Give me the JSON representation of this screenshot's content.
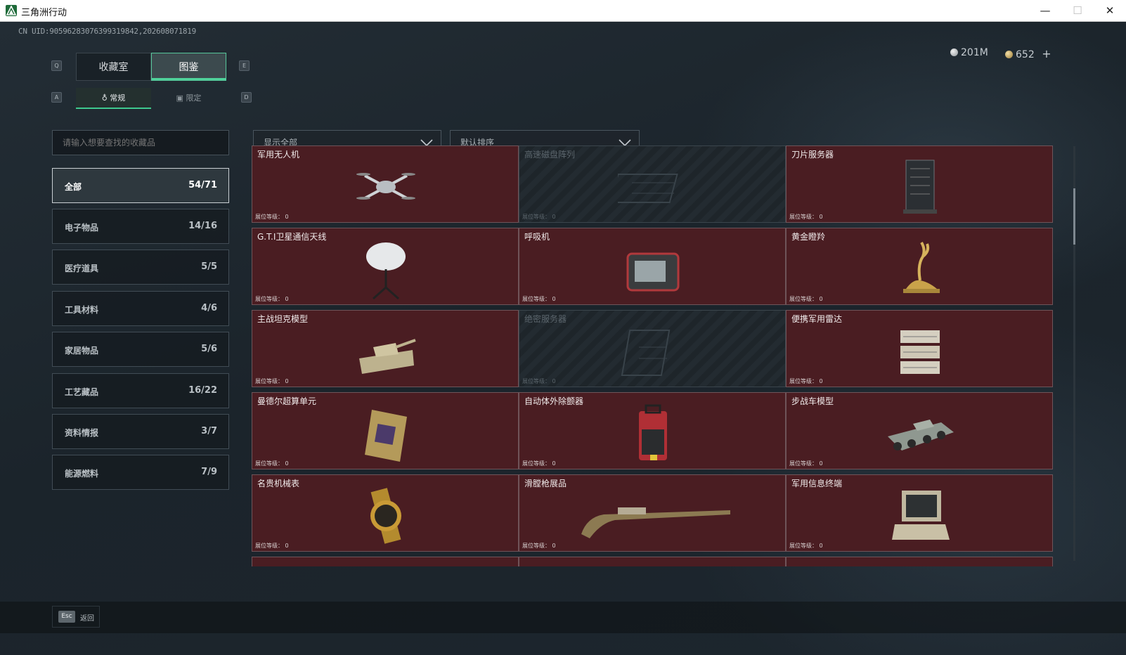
{
  "window": {
    "title": "三角洲行动",
    "minimize": "—",
    "maximize": "☐",
    "close": "✕"
  },
  "uid": "CN UID:9059628307639931984​2,202608071819",
  "keys": {
    "q": "Q",
    "e": "E",
    "a": "A",
    "d": "D",
    "esc": "Esc"
  },
  "main_tabs": [
    {
      "label": "收藏室"
    },
    {
      "label": "图鉴"
    }
  ],
  "sub_tabs": [
    {
      "label": "常规"
    },
    {
      "label": "限定"
    }
  ],
  "currency": {
    "silver": "201M",
    "gold": "652",
    "add": "+"
  },
  "search": {
    "placeholder": "请输入想要查找的收藏品"
  },
  "filters": {
    "show": "显示全部",
    "sort": "默认排序"
  },
  "categories": [
    {
      "label": "全部",
      "count": "54/71"
    },
    {
      "label": "电子物品",
      "count": "14/16"
    },
    {
      "label": "医疗道具",
      "count": "5/5"
    },
    {
      "label": "工具材料",
      "count": "4/6"
    },
    {
      "label": "家居物品",
      "count": "5/6"
    },
    {
      "label": "工艺藏品",
      "count": "16/22"
    },
    {
      "label": "资料情报",
      "count": "3/7"
    },
    {
      "label": "能源燃料",
      "count": "7/9"
    }
  ],
  "level_label": "展位等级：",
  "items": [
    {
      "name": "军用无人机",
      "level": "0",
      "icon": "drone-icon",
      "locked": false
    },
    {
      "name": "高速磁盘阵列",
      "level": "0",
      "icon": "disk-array-icon",
      "locked": true
    },
    {
      "name": "刀片服务器",
      "level": "0",
      "icon": "blade-server-icon",
      "locked": false
    },
    {
      "name": "G.T.I卫星通信天线",
      "level": "0",
      "icon": "satellite-antenna-icon",
      "locked": false
    },
    {
      "name": "呼吸机",
      "level": "0",
      "icon": "ventilator-icon",
      "locked": false
    },
    {
      "name": "黄金瞪羚",
      "level": "0",
      "icon": "golden-gazelle-icon",
      "locked": false
    },
    {
      "name": "主战坦克模型",
      "level": "0",
      "icon": "tank-model-icon",
      "locked": false
    },
    {
      "name": "绝密服务器",
      "level": "0",
      "icon": "secret-server-icon",
      "locked": true
    },
    {
      "name": "便携军用雷达",
      "level": "0",
      "icon": "radar-icon",
      "locked": false
    },
    {
      "name": "曼德尔超算单元",
      "level": "0",
      "icon": "supercomputer-unit-icon",
      "locked": false
    },
    {
      "name": "自动体外除颤器",
      "level": "0",
      "icon": "defibrillator-icon",
      "locked": false
    },
    {
      "name": "步战车模型",
      "level": "0",
      "icon": "ifv-model-icon",
      "locked": false
    },
    {
      "name": "名贵机械表",
      "level": "0",
      "icon": "watch-icon",
      "locked": false
    },
    {
      "name": "滑膛枪展品",
      "level": "0",
      "icon": "musket-icon",
      "locked": false
    },
    {
      "name": "军用信息终端",
      "level": "0",
      "icon": "info-terminal-icon",
      "locked": false
    }
  ],
  "bottom": {
    "back": "返回"
  },
  "colors": {
    "accent": "#4fd19a",
    "card_bg": "#4a1d22",
    "locked_bg": "#232b31"
  }
}
